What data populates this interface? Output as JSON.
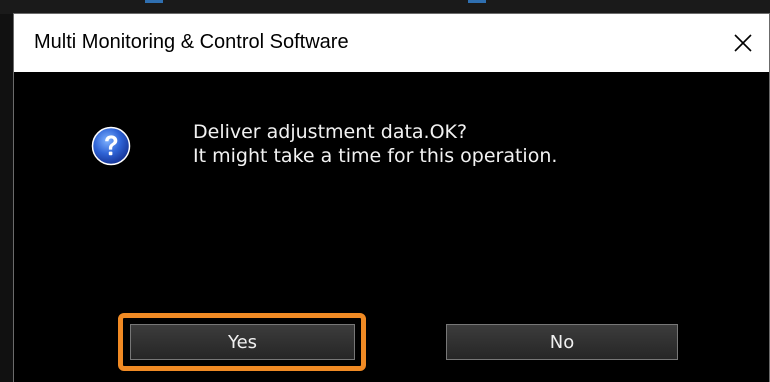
{
  "dialog": {
    "title": "Multi Monitoring & Control Software",
    "message_line1": "Deliver adjustment data.OK?",
    "message_line2": "It might take a time for this operation.",
    "icon": "question-icon",
    "buttons": {
      "yes_label": "Yes",
      "no_label": "No"
    },
    "close_icon": "close-icon"
  },
  "highlight": {
    "target": "yes-button",
    "color": "#f08a24"
  },
  "colors": {
    "body_background": "#000000",
    "titlebar_background": "#ffffff",
    "text": "#f2f2f2"
  }
}
